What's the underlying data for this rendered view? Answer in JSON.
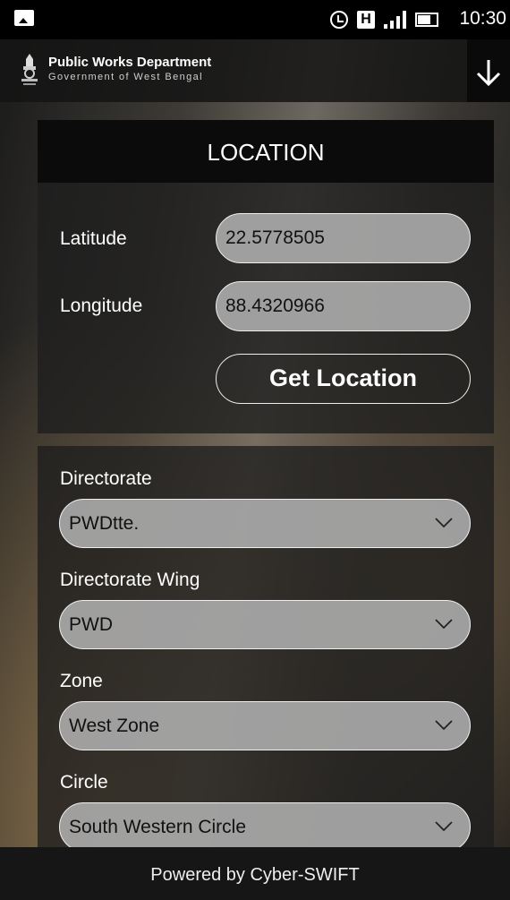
{
  "status_bar": {
    "time": "10:30",
    "network_badge": "H"
  },
  "header": {
    "title": "Public Works Department",
    "subtitle": "Government of West Bengal",
    "download_icon": "arrow-down-icon"
  },
  "location_card": {
    "heading": "LOCATION",
    "latitude_label": "Latitude",
    "latitude_value": "22.5778505",
    "longitude_label": "Longitude",
    "longitude_value": "88.4320966",
    "get_location_label": "Get Location"
  },
  "selection_card": {
    "fields": [
      {
        "label": "Directorate",
        "value": "PWDtte."
      },
      {
        "label": "Directorate Wing",
        "value": "PWD"
      },
      {
        "label": "Zone",
        "value": "West Zone"
      },
      {
        "label": "Circle",
        "value": "South Western Circle"
      }
    ]
  },
  "footer": {
    "text": "Powered by Cyber-SWIFT"
  }
}
